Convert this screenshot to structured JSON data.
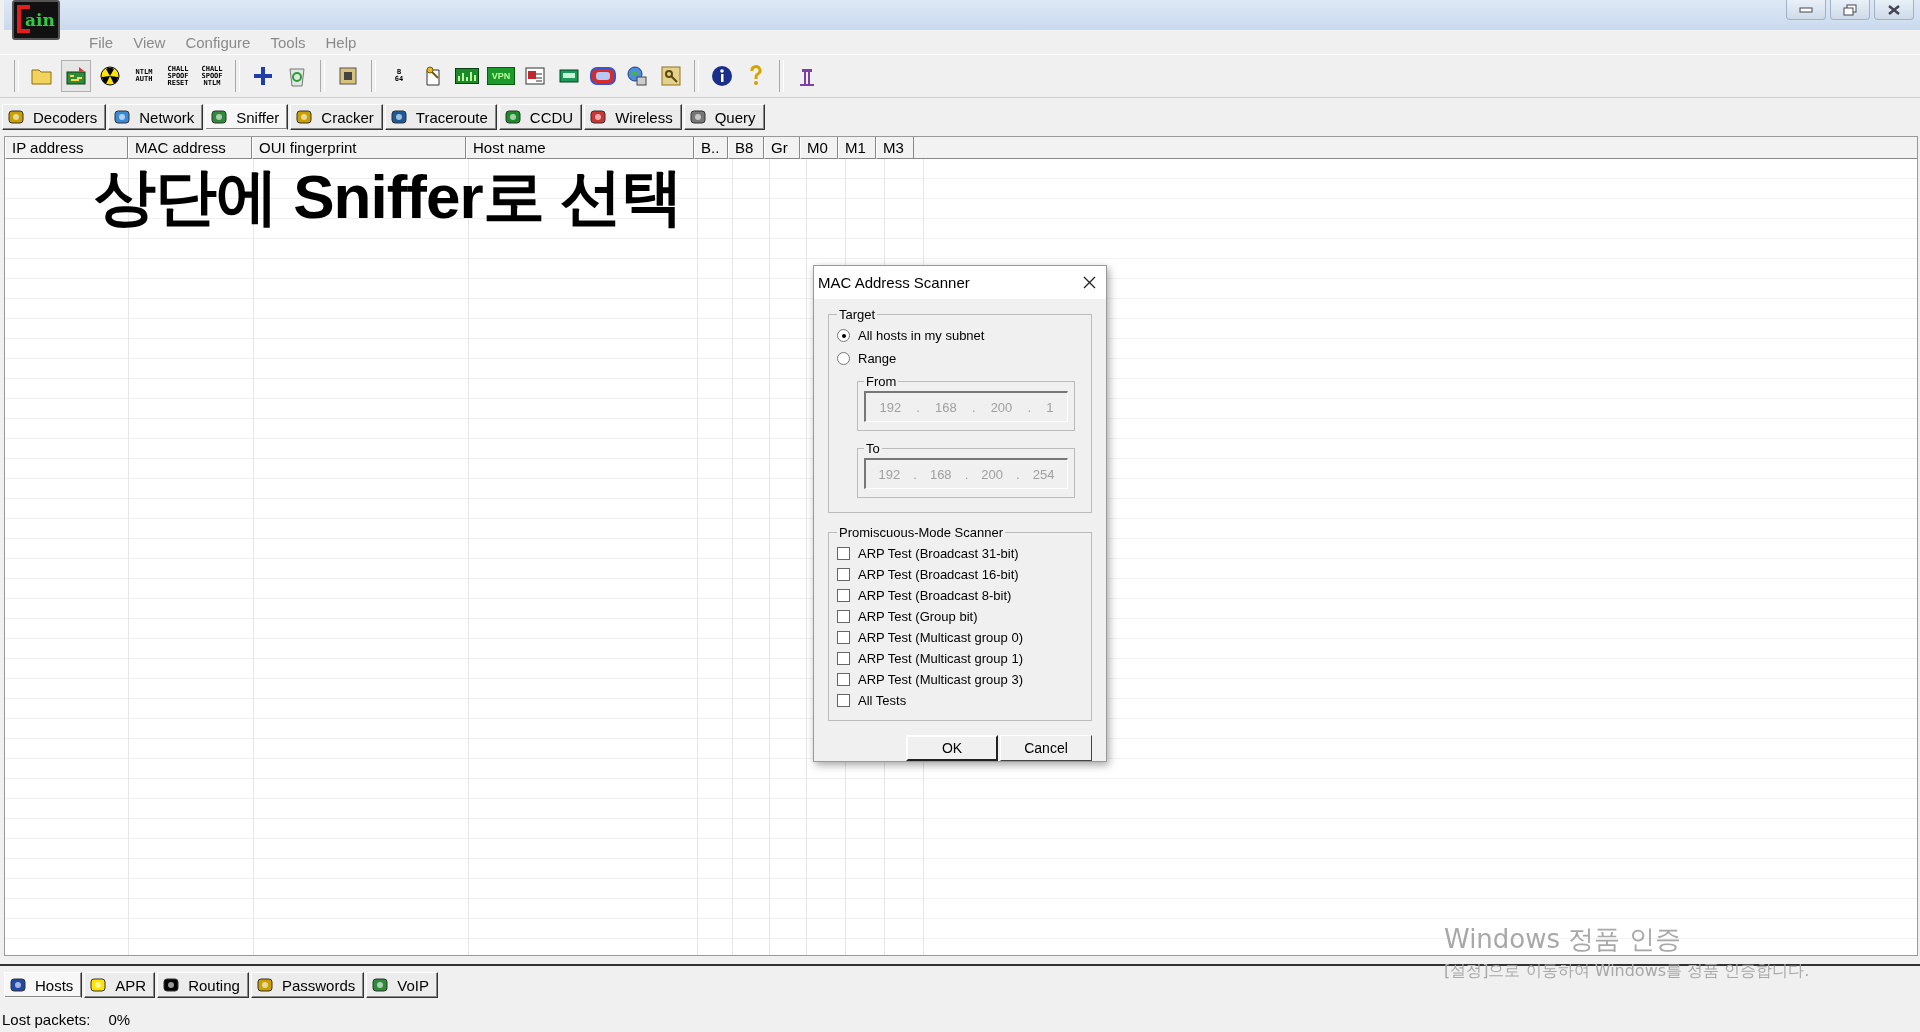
{
  "window": {
    "logo_text": "ain"
  },
  "menu": [
    "File",
    "View",
    "Configure",
    "Tools",
    "Help"
  ],
  "toolbar": [
    {
      "kind": "sep"
    },
    {
      "kind": "icon",
      "pressed": false
    },
    {
      "kind": "icon",
      "pressed": true
    },
    {
      "kind": "icon",
      "pressed": false
    },
    {
      "kind": "text",
      "lines": [
        "NTLM",
        "AUTH"
      ],
      "pressed": false
    },
    {
      "kind": "text",
      "lines": [
        "CHALL",
        "SPOOF",
        "RESET"
      ],
      "pressed": false
    },
    {
      "kind": "text",
      "lines": [
        "CHALL",
        "SPOOF",
        "NTLM"
      ],
      "pressed": false
    },
    {
      "kind": "sep"
    },
    {
      "kind": "icon",
      "pressed": false
    },
    {
      "kind": "icon",
      "pressed": false
    },
    {
      "kind": "sep"
    },
    {
      "kind": "icon",
      "pressed": false
    },
    {
      "kind": "sep"
    },
    {
      "kind": "text",
      "lines": [
        "B",
        "64"
      ],
      "pressed": false
    },
    {
      "kind": "icon",
      "pressed": false
    },
    {
      "kind": "icon",
      "pressed": false
    },
    {
      "kind": "chip",
      "lines": [
        "VPN"
      ],
      "pressed": false
    },
    {
      "kind": "icon",
      "pressed": false
    },
    {
      "kind": "icon",
      "pressed": false
    },
    {
      "kind": "icon",
      "pressed": false
    },
    {
      "kind": "icon",
      "pressed": false
    },
    {
      "kind": "icon",
      "pressed": false
    },
    {
      "kind": "sep"
    },
    {
      "kind": "icon",
      "pressed": false
    },
    {
      "kind": "icon",
      "pressed": false
    },
    {
      "kind": "sep"
    },
    {
      "kind": "icon",
      "pressed": false
    }
  ],
  "tabs": [
    {
      "label": "Decoders",
      "selected": false
    },
    {
      "label": "Network",
      "selected": false
    },
    {
      "label": "Sniffer",
      "selected": true
    },
    {
      "label": "Cracker",
      "selected": false
    },
    {
      "label": "Traceroute",
      "selected": false
    },
    {
      "label": "CCDU",
      "selected": false
    },
    {
      "label": "Wireless",
      "selected": false
    },
    {
      "label": "Query",
      "selected": false
    }
  ],
  "table": {
    "columns": [
      "IP address",
      "MAC address",
      "OUI fingerprint",
      "Host name",
      "B..",
      "B8",
      "Gr",
      "M0",
      "M1",
      "M3"
    ]
  },
  "annotation": "상단에 Sniffer로 선택",
  "dialog": {
    "title": "MAC Address Scanner",
    "target": {
      "title": "Target",
      "options": [
        {
          "label": "All hosts in my subnet",
          "selected": true
        },
        {
          "label": "Range",
          "selected": false
        }
      ],
      "from": {
        "label": "From",
        "separator": ".",
        "octets": [
          "192",
          "168",
          "200",
          "1"
        ]
      },
      "to": {
        "label": "To",
        "separator": ".",
        "octets": [
          "192",
          "168",
          "200",
          "254"
        ]
      }
    },
    "scanner": {
      "title": "Promiscuous-Mode Scanner",
      "tests": [
        {
          "label": "ARP Test (Broadcast 31-bit)",
          "checked": false
        },
        {
          "label": "ARP Test (Broadcast 16-bit)",
          "checked": false
        },
        {
          "label": "ARP Test (Broadcast 8-bit)",
          "checked": false
        },
        {
          "label": "ARP Test (Group bit)",
          "checked": false
        },
        {
          "label": "ARP Test (Multicast group 0)",
          "checked": false
        },
        {
          "label": "ARP Test (Multicast group 1)",
          "checked": false
        },
        {
          "label": "ARP Test (Multicast group 3)",
          "checked": false
        },
        {
          "label": "All Tests",
          "checked": false
        }
      ]
    },
    "buttons": [
      "OK",
      "Cancel"
    ]
  },
  "bottom_tabs": [
    {
      "label": "Hosts",
      "selected": true
    },
    {
      "label": "APR",
      "selected": false
    },
    {
      "label": "Routing",
      "selected": false
    },
    {
      "label": "Passwords",
      "selected": false
    },
    {
      "label": "VoIP",
      "selected": false
    }
  ],
  "status_bar": {
    "label": "Lost packets:",
    "value": "0%"
  },
  "activation": {
    "title": "Windows 정품 인증",
    "message": "[설정]으로 이동하여 Windows를 정품 인증합니다."
  }
}
